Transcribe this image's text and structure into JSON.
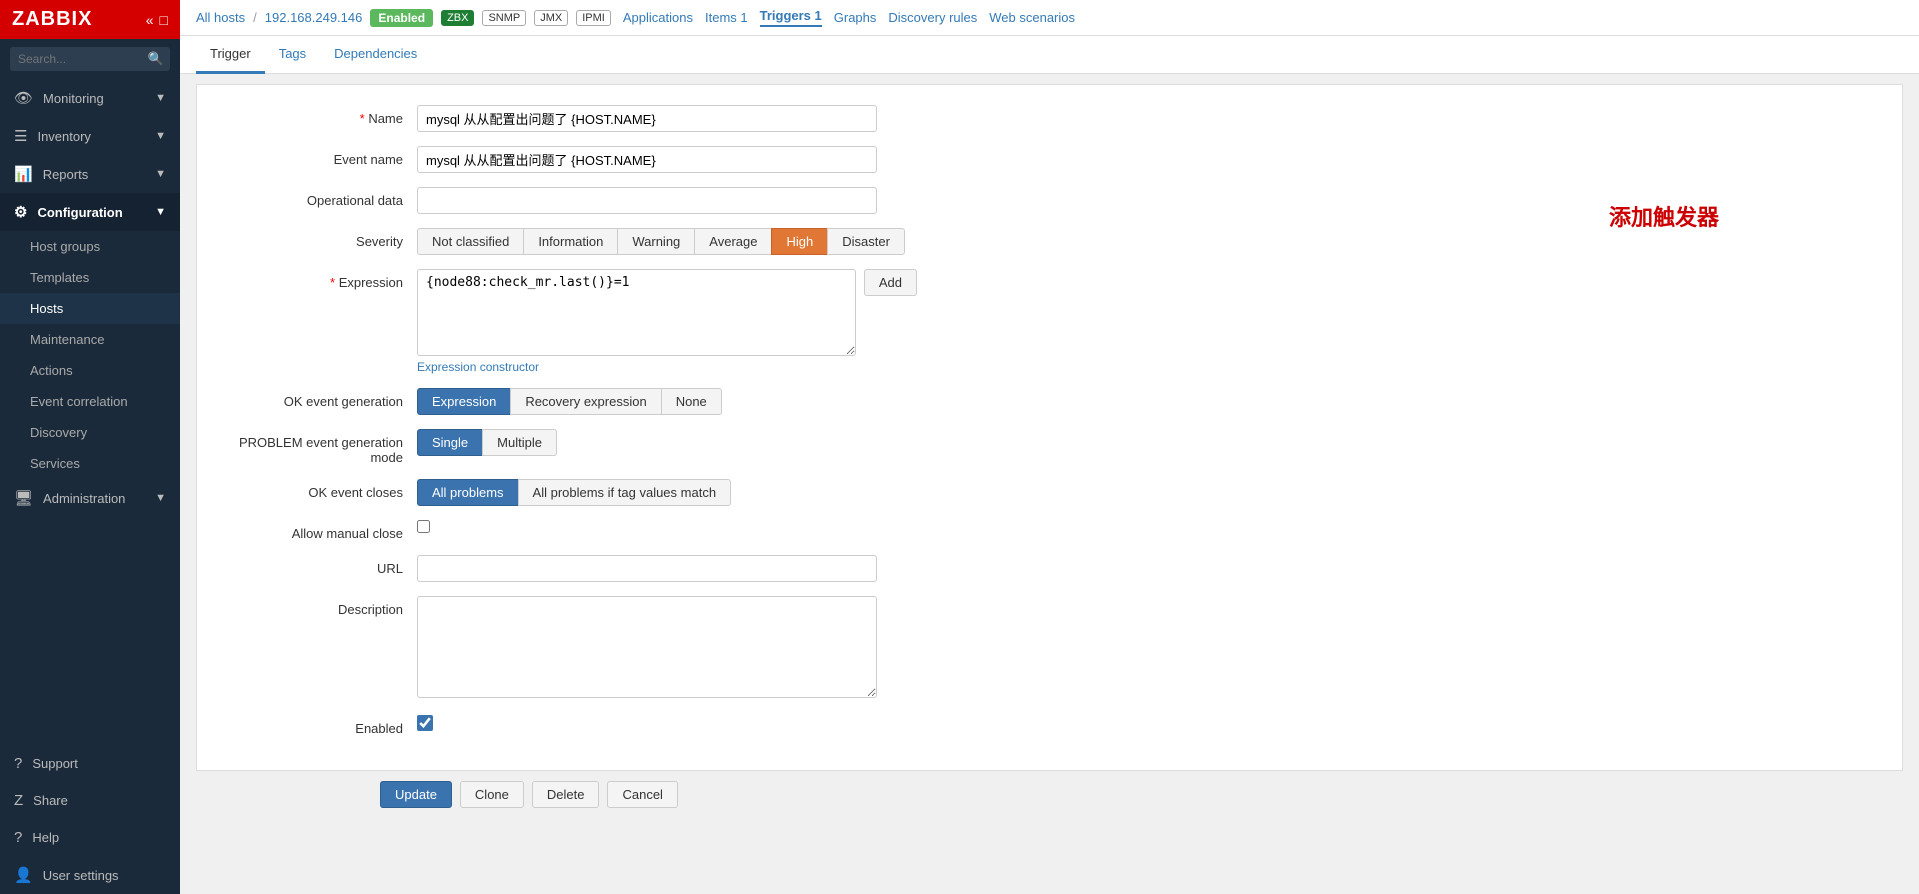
{
  "sidebar": {
    "logo": "ZABBIX",
    "search_placeholder": "Search...",
    "nav": [
      {
        "id": "monitoring",
        "label": "Monitoring",
        "icon": "👁",
        "has_arrow": true
      },
      {
        "id": "inventory",
        "label": "Inventory",
        "icon": "☰",
        "has_arrow": true
      },
      {
        "id": "reports",
        "label": "Reports",
        "icon": "📊",
        "has_arrow": true
      },
      {
        "id": "configuration",
        "label": "Configuration",
        "icon": "⚙",
        "has_arrow": true,
        "open": true
      },
      {
        "id": "administration",
        "label": "Administration",
        "icon": "🖥",
        "has_arrow": true
      }
    ],
    "config_sub": [
      {
        "id": "host-groups",
        "label": "Host groups"
      },
      {
        "id": "templates",
        "label": "Templates"
      },
      {
        "id": "hosts",
        "label": "Hosts",
        "active": true
      },
      {
        "id": "maintenance",
        "label": "Maintenance"
      },
      {
        "id": "actions",
        "label": "Actions"
      },
      {
        "id": "event-correlation",
        "label": "Event correlation"
      },
      {
        "id": "discovery",
        "label": "Discovery"
      },
      {
        "id": "services",
        "label": "Services"
      }
    ],
    "bottom_nav": [
      {
        "id": "support",
        "label": "Support",
        "icon": "?"
      },
      {
        "id": "share",
        "label": "Share",
        "icon": "Z"
      },
      {
        "id": "help",
        "label": "Help",
        "icon": "?"
      },
      {
        "id": "user-settings",
        "label": "User settings",
        "icon": "👤"
      }
    ]
  },
  "topbar": {
    "breadcrumb": [
      {
        "label": "All hosts",
        "link": true
      },
      {
        "sep": "/"
      },
      {
        "label": "192.168.249.146",
        "link": true
      }
    ],
    "status_badge": "Enabled",
    "proto_badges": [
      {
        "label": "ZBX",
        "active": true
      },
      {
        "label": "SNMP"
      },
      {
        "label": "JMX"
      },
      {
        "label": "IPMI"
      }
    ],
    "nav_links": [
      {
        "label": "Applications"
      },
      {
        "label": "Items 1"
      },
      {
        "label": "Triggers 1",
        "active": true
      },
      {
        "label": "Graphs"
      },
      {
        "label": "Discovery rules"
      },
      {
        "label": "Web scenarios"
      }
    ]
  },
  "tabs": [
    {
      "id": "trigger",
      "label": "Trigger",
      "active": true
    },
    {
      "id": "tags",
      "label": "Tags"
    },
    {
      "id": "dependencies",
      "label": "Dependencies"
    }
  ],
  "form": {
    "name_label": "Name",
    "name_value": "mysql 从从配置出问题了 {HOST.NAME}",
    "event_name_label": "Event name",
    "event_name_value": "mysql 从从配置出问题了 {HOST.NAME}",
    "operational_data_label": "Operational data",
    "operational_data_value": "",
    "severity_label": "Severity",
    "severity_options": [
      {
        "label": "Not classified",
        "active": false
      },
      {
        "label": "Information",
        "active": false
      },
      {
        "label": "Warning",
        "active": false
      },
      {
        "label": "Average",
        "active": false
      },
      {
        "label": "High",
        "active": true
      },
      {
        "label": "Disaster",
        "active": false
      }
    ],
    "expression_label": "Expression",
    "expression_value": "{node88:check_mr.last()}=1",
    "add_button": "Add",
    "expression_constructor_link": "Expression constructor",
    "ok_event_label": "OK event generation",
    "ok_event_options": [
      {
        "label": "Expression",
        "active": true
      },
      {
        "label": "Recovery expression",
        "active": false
      },
      {
        "label": "None",
        "active": false
      }
    ],
    "problem_mode_label": "PROBLEM event generation mode",
    "problem_mode_options": [
      {
        "label": "Single",
        "active": true
      },
      {
        "label": "Multiple",
        "active": false
      }
    ],
    "ok_closes_label": "OK event closes",
    "ok_closes_options": [
      {
        "label": "All problems",
        "active": true
      },
      {
        "label": "All problems if tag values match",
        "active": false
      }
    ],
    "allow_manual_close_label": "Allow manual close",
    "url_label": "URL",
    "url_value": "",
    "description_label": "Description",
    "description_value": "",
    "enabled_label": "Enabled",
    "enabled_checked": true
  },
  "action_buttons": {
    "update": "Update",
    "clone": "Clone",
    "delete": "Delete",
    "cancel": "Cancel"
  },
  "annotation": "添加触发器"
}
